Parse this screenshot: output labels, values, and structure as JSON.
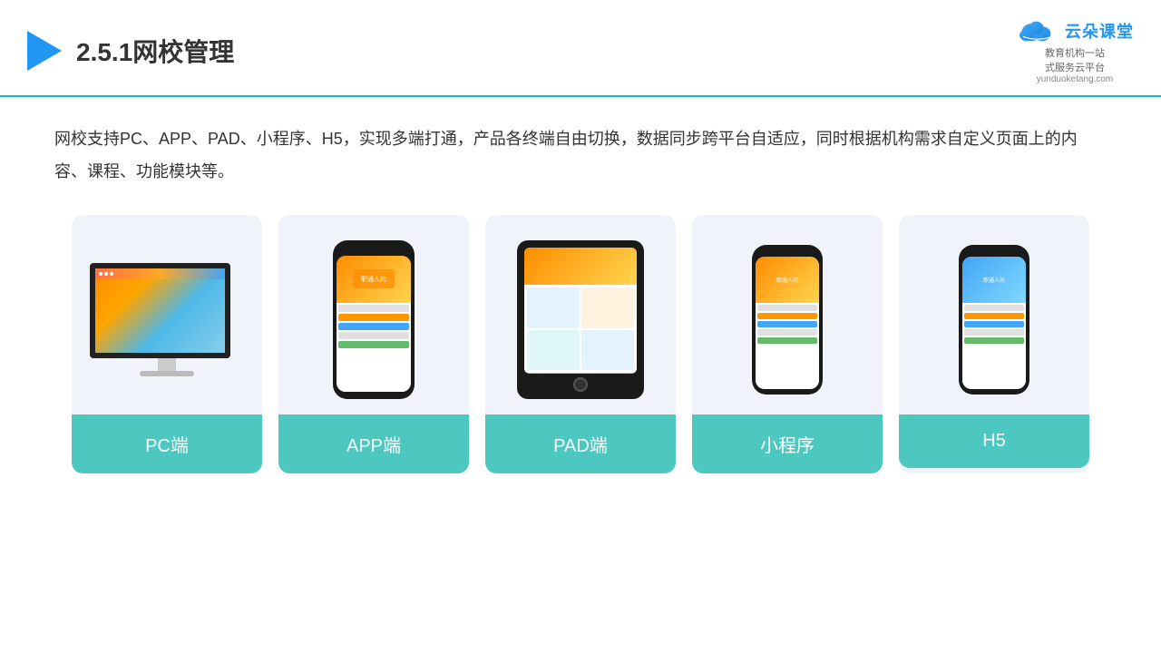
{
  "header": {
    "title": "2.5.1网校管理",
    "logo_name": "云朵课堂",
    "logo_url": "yunduoketang.com",
    "logo_tagline": "教育机构一站",
    "logo_tagline2": "式服务云平台"
  },
  "description": {
    "text": "网校支持PC、APP、PAD、小程序、H5，实现多端打通，产品各终端自由切换，数据同步跨平台自适应，同时根据机构需求自定义页面上的内容、课程、功能模块等。"
  },
  "cards": [
    {
      "id": "pc",
      "label": "PC端"
    },
    {
      "id": "app",
      "label": "APP端"
    },
    {
      "id": "pad",
      "label": "PAD端"
    },
    {
      "id": "miniprogram",
      "label": "小程序"
    },
    {
      "id": "h5",
      "label": "H5"
    }
  ],
  "colors": {
    "accent": "#4dc8c0",
    "header_line": "#1ab8c8",
    "card_bg": "#f0f4fa",
    "text_dark": "#333333",
    "brand_blue": "#2196f3"
  }
}
